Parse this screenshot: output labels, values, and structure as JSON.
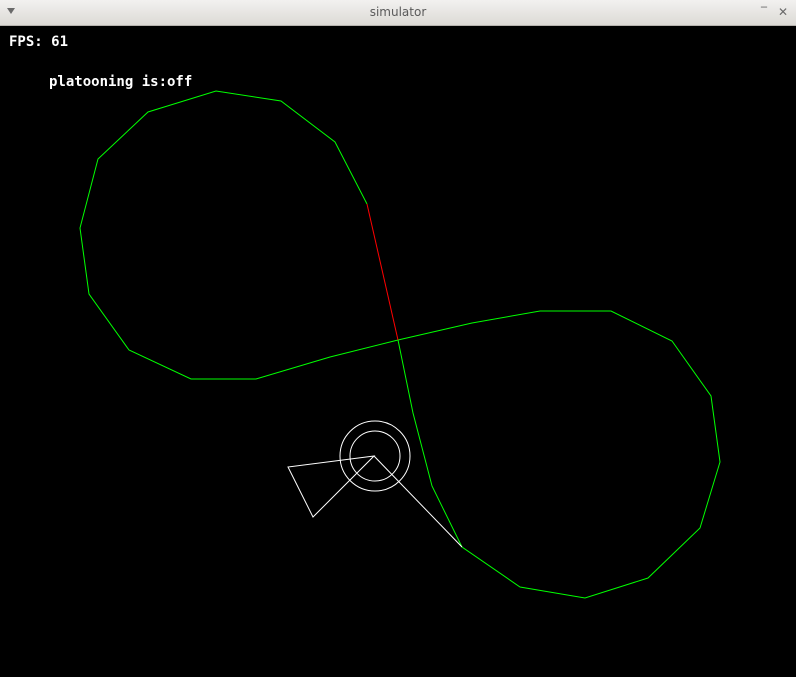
{
  "window": {
    "title": "simulator",
    "minimize_glyph": "‾",
    "close_glyph": "✕",
    "menu_icon": "chevron-down-icon"
  },
  "hud": {
    "fps_text": "FPS: 61",
    "platooning_text": "platooning is:off"
  },
  "colors": {
    "track": "#00ff00",
    "active_segment": "#ff0000",
    "vehicle": "#ffffff",
    "background": "#000000"
  }
}
